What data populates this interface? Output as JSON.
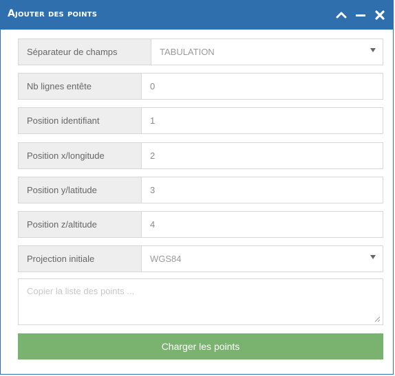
{
  "window": {
    "title": "Ajouter des points",
    "colors": {
      "titlebar": "#2f6fae",
      "button": "#79b36f"
    },
    "controls": [
      {
        "icon": "chevron-up-icon"
      },
      {
        "icon": "minimize-icon"
      },
      {
        "icon": "close-icon"
      }
    ]
  },
  "form": {
    "separator": {
      "label": "Séparateur de champs",
      "value": "TABULATION"
    },
    "header_lines": {
      "label": "Nb lignes entête",
      "value": "0"
    },
    "id_position": {
      "label": "Position identifiant",
      "value": "1"
    },
    "x_position": {
      "label": "Position x/longitude",
      "value": "2"
    },
    "y_position": {
      "label": "Position y/latitude",
      "value": "3"
    },
    "z_position": {
      "label": "Position z/altitude",
      "value": "4"
    },
    "projection": {
      "label": "Projection initiale",
      "value": "WGS84"
    },
    "points_textarea": {
      "placeholder": "Copier la liste des points ..."
    },
    "submit_label": "Charger les points"
  }
}
